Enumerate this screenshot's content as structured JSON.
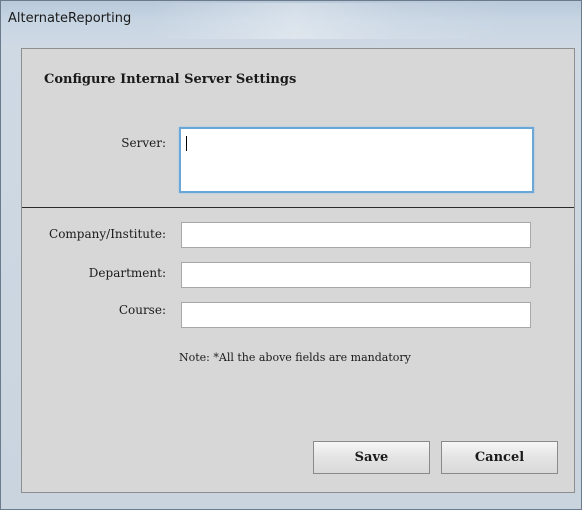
{
  "window": {
    "title": "AlternateReporting"
  },
  "dialog": {
    "heading": "Configure Internal Server Settings",
    "fields": {
      "server_label": "Server:",
      "server_value": "",
      "company_label": "Company/Institute:",
      "company_value": "",
      "department_label": "Department:",
      "department_value": "",
      "course_label": "Course:",
      "course_value": ""
    },
    "note": "Note: *All the above fields are mandatory",
    "buttons": {
      "save_label": "Save",
      "cancel_label": "Cancel"
    }
  },
  "colors": {
    "focus_border": "#6ba7d6",
    "client_background": "#d7d7d7"
  }
}
